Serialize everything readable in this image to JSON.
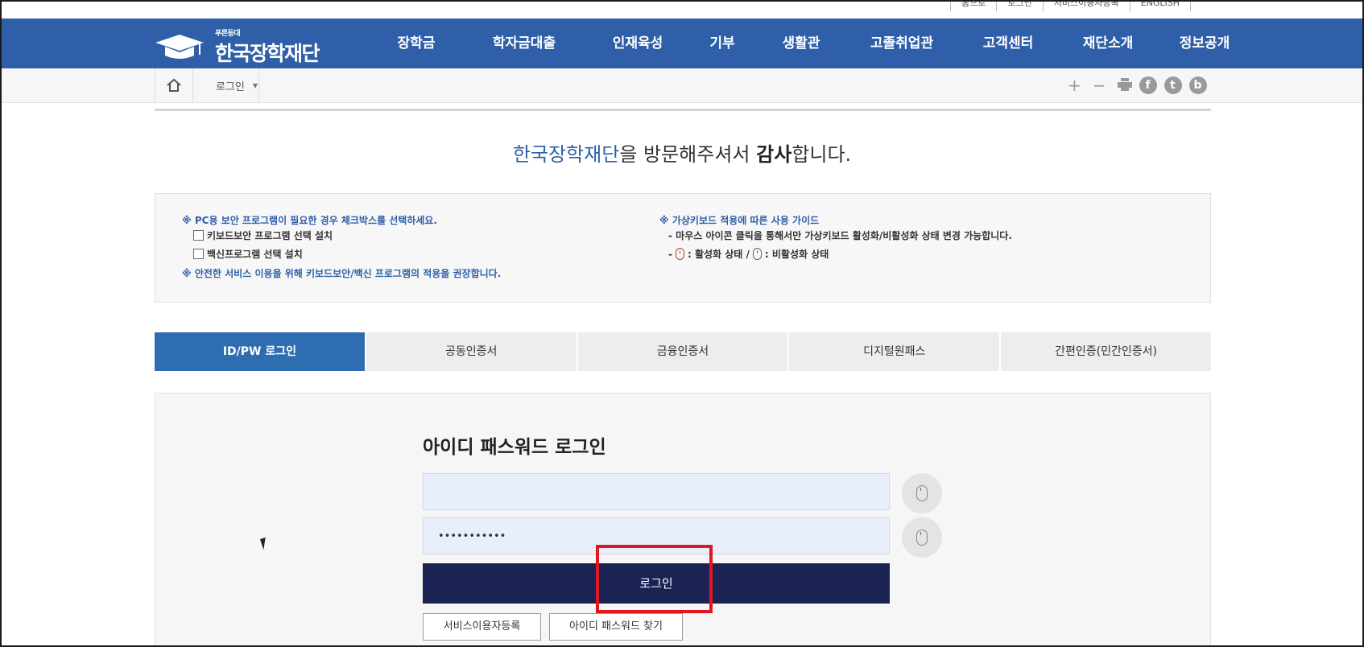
{
  "util_links": [
    "홈으로",
    "로그인",
    "서비스이용자등록",
    "ENGLISH"
  ],
  "logo": {
    "small": "푸른등대",
    "big": "한국장학재단"
  },
  "gnb": [
    "장학금",
    "학자금대출",
    "인재육성",
    "기부",
    "생활관",
    "고졸취업관",
    "고객센터",
    "재단소개",
    "정보공개"
  ],
  "breadcrumb": {
    "current": "로그인"
  },
  "tools": {
    "plus": "+",
    "minus": "−",
    "facebook": "f",
    "twitter": "t",
    "blog": "b"
  },
  "welcome": {
    "name": "한국장학재단",
    "mid": "을 방문해주셔서 ",
    "bold": "감사",
    "end": "합니다."
  },
  "notice": {
    "left_title": "※ PC용 보안 프로그램이 필요한 경우 체크박스를 선택하세요.",
    "check1": "키보드보안 프로그램 선택 설치",
    "check2": "백신프로그램 선택 설치",
    "left_footer": "※ 안전한 서비스 이용을 위해 키보드보안/백신 프로그램의 적용을 권장합니다.",
    "right_title": "※ 가상키보드 적용에 따른 사용 가이드",
    "right_line1": "- 마우스 아이콘 클릭을 통해서만 가상키보드 활성화/비활성화 상태 변경 가능합니다.",
    "right_line2_a": ": 활성화 상태 /",
    "right_line2_b": ": 비활성화 상태"
  },
  "tabs": [
    "ID/PW 로그인",
    "공동인증서",
    "금융인증서",
    "디지털원패스",
    "간편인증(민간인증서)"
  ],
  "login": {
    "title": "아이디 패스워드 로그인",
    "id_value": "",
    "pw_value": "•••••••••••",
    "login_button": "로그인",
    "register_button": "서비스이용자등록",
    "find_button": "아이디 패스워드 찾기"
  },
  "colors": {
    "brand": "#2f5fa8",
    "active_tab": "#2e6db0",
    "login_button": "#1b2254",
    "highlight": "#e0181e"
  }
}
